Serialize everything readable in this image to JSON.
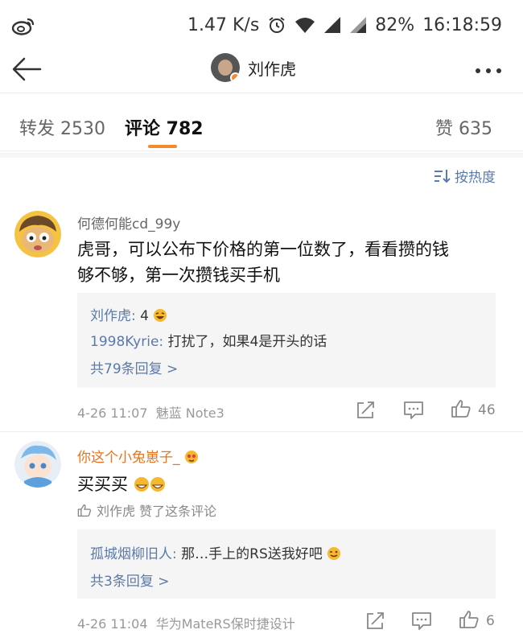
{
  "status_bar": {
    "speed": "1.47 K/s",
    "battery": "82%",
    "time": "16:18:59"
  },
  "nav": {
    "title": "刘作虎"
  },
  "tabs": {
    "repost": "转发 2530",
    "comment": "评论 782",
    "like": "赞 635"
  },
  "sort": {
    "label": "按热度"
  },
  "comments": [
    {
      "username": "何德何能cd_99y",
      "text_line1": "虎哥，可以公布下价格的第一位数了，看看攒的钱",
      "text_line2": "够不够，第一次攒钱买手机",
      "replies": [
        {
          "name": "刘作虎:",
          "text": " 4"
        },
        {
          "name": "1998Kyrie:",
          "text": " 打扰了，如果4是开头的话"
        }
      ],
      "more_replies": "共79条回复 >",
      "time": "4-26 11:07",
      "device": "魅蓝 Note3",
      "likes": "46"
    },
    {
      "username": "你这个小兔崽子_",
      "text": "买买买",
      "liked_by": "刘作虎 赞了这条评论",
      "replies": [
        {
          "name": "孤城烟柳旧人:",
          "text": " 那…手上的RS送我好吧"
        }
      ],
      "more_replies": "共3条回复 >",
      "time": "4-26 11:04",
      "device": "华为MateRS保时捷设计",
      "likes": "6"
    }
  ],
  "colors": {
    "accent": "#f38a2b",
    "link": "#5b7aa8",
    "orange_name": "#e8731c"
  }
}
